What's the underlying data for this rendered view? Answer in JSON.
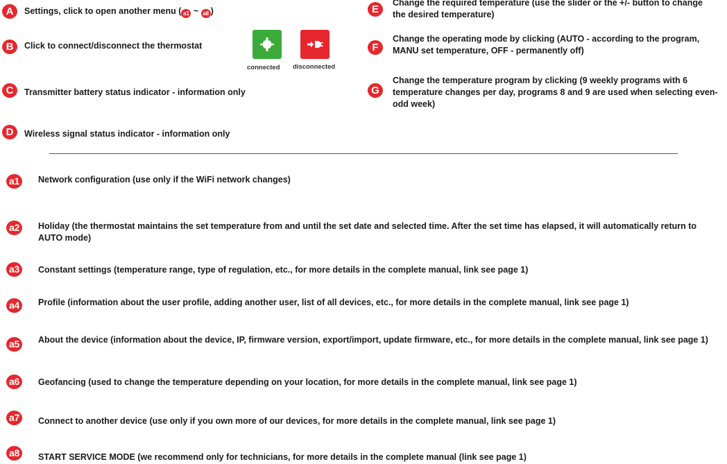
{
  "top": {
    "A": {
      "badge": "A",
      "pre": "Settings, click to open another menu (",
      "mini1": "a1",
      "sep": " ~ ",
      "mini2": "a8",
      "post": ")"
    },
    "B": {
      "badge": "B",
      "text": "Click to connect/disconnect the thermostat"
    },
    "C": {
      "badge": "C",
      "text": "Transmitter battery status indicator - information only"
    },
    "D": {
      "badge": "D",
      "text": "Wireless signal status indicator - information only"
    },
    "E": {
      "badge": "E",
      "text": "Change the required temperature (use the slider or the +/- button to change the desired temperature)"
    },
    "F": {
      "badge": "F",
      "text": "Change the operating mode by clicking (AUTO - according to the program, MANU set temperature, OFF - permanently off)"
    },
    "G": {
      "badge": "G",
      "text": "Change the temperature program by clicking (9 weekly programs with 6 temperature changes per day, programs 8 and 9 are used when selecting even-odd week)"
    }
  },
  "status_icons": {
    "connected": {
      "label": "connected",
      "color": "#3aab3a",
      "icon": "plug-connected-icon"
    },
    "disconnected": {
      "label": "disconnected",
      "color": "#e6272e",
      "icon": "plug-disconnected-icon"
    }
  },
  "menu": [
    {
      "badge": "a1",
      "text": "Network configuration (use only if the WiFi network changes)"
    },
    {
      "badge": "a2",
      "text": "Holiday (the thermostat maintains the set temperature from and until the set date and selected time. After the set time has elapsed, it will automatically return to AUTO mode)"
    },
    {
      "badge": "a3",
      "text": "Constant settings (temperature range, type of regulation, etc., for more details in the complete manual, link see page 1)"
    },
    {
      "badge": "a4",
      "text": "Profile (information about the user profile, adding another user, list of all devices, etc., for more details in the complete manual, link see page 1)"
    },
    {
      "badge": "a5",
      "text": "About the device (information about the device, IP, firmware version, export/import, update firmware, etc., for more details in the complete manual, link see page 1)"
    },
    {
      "badge": "a6",
      "text": "Geofancing (used to change the temperature depending on your location, for more details in the complete manual, link see page 1)"
    },
    {
      "badge": "a7",
      "text": "Connect to another device (use only if you own more of our devices, for more details in the complete manual, link see page 1)"
    },
    {
      "badge": "a8",
      "text": "START SERVICE MODE (we recommend only for technicians, for more details in the complete manual (link see page 1)"
    }
  ],
  "accent_color": "#e6272e"
}
